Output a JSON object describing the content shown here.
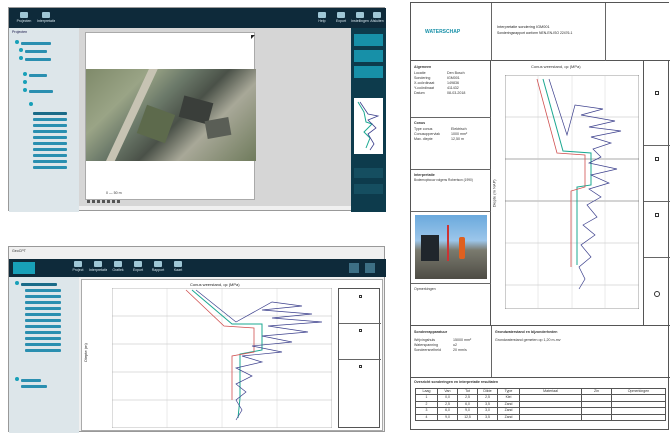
{
  "screen1": {
    "toolbar": [
      {
        "label": "Projecten",
        "icon": "folder-icon"
      },
      {
        "label": "Interpretatie",
        "icon": "layers-icon"
      }
    ],
    "toolbar_right": [
      {
        "label": "Help",
        "icon": "help-icon"
      },
      {
        "label": "Export",
        "icon": "export-icon"
      },
      {
        "label": "Instellingen",
        "icon": "gear-icon"
      },
      {
        "label": "Afsluiten",
        "icon": "close-icon"
      }
    ],
    "tree_header": "Projecten",
    "map_scale": "0 — 50 m"
  },
  "screen2": {
    "title": "GeoCPT",
    "toolbar": [
      {
        "label": "Project"
      },
      {
        "label": "Interpretatie"
      },
      {
        "label": "Grafiek"
      },
      {
        "label": "Export"
      },
      {
        "label": "Rapport"
      },
      {
        "label": "Kaart"
      }
    ],
    "chart_title": "Conus weerstand, qc (MPa)",
    "y_axis_label": "Diepte (m)"
  },
  "report": {
    "logo_text": "WATERSCHAP",
    "header_title": "Interpretatie sondering IGM001",
    "header_subtitle": "Sonderingsrapport conform NEN-EN-ISO 22476-1",
    "info_heading": "Algemeen",
    "info_rows": [
      {
        "label": "Locatie",
        "value": "Den Bosch"
      },
      {
        "label": "Sondering",
        "value": "IGM001"
      },
      {
        "label": "X-coördinaat",
        "value": "149836"
      },
      {
        "label": "Y-coördinaat",
        "value": "411432"
      },
      {
        "label": "Datum",
        "value": "08-03-2018"
      }
    ],
    "section2_heading": "Conus",
    "section2_rows": [
      {
        "label": "Type conus",
        "value": "Elektrisch"
      },
      {
        "label": "Conusoppervlak",
        "value": "1000 mm²"
      },
      {
        "label": "Max. diepte",
        "value": "12,50 m"
      }
    ],
    "section3_heading": "Interpretatie",
    "section3_text": "Bodemopbouw volgens Robertson (1990)",
    "photo_caption": "Opmerkingen",
    "chart_title": "Conus weerstand, qc (MPa)",
    "y_axis_label": "Diepte (m NAP)",
    "footer_left_title": "Sondeerapparatuur",
    "footer_rows": [
      {
        "label": "Wrijvingshuls",
        "value": "15000 mm²"
      },
      {
        "label": "Waterspanning",
        "value": "u2"
      },
      {
        "label": "Sondeersnelheid",
        "value": "20 mm/s"
      }
    ],
    "footer_right_title": "Grondwaterstand en bijzonderheden",
    "footer_right_text": "Grondwaterstand gemeten op 1,20 m-mv",
    "table_title": "Overzicht sonderingen en interpretatie resultaten",
    "table_headers": [
      "Laag",
      "Van",
      "Tot",
      "Dikte",
      "Type",
      "Materiaal",
      "Zin",
      "Opmerkingen"
    ],
    "table_rows": [
      [
        "1",
        "0,0",
        "2,5",
        "2,5",
        "Klei",
        "",
        "",
        ""
      ],
      [
        "2",
        "2,5",
        "6,0",
        "3,5",
        "Zand",
        "",
        "",
        ""
      ],
      [
        "3",
        "6,0",
        "9,0",
        "3,0",
        "Zand",
        "",
        "",
        ""
      ],
      [
        "4",
        "9,0",
        "12,5",
        "3,5",
        "Zand",
        "",
        "",
        ""
      ]
    ]
  },
  "colors": {
    "toolbar": "#0e2a3a",
    "accent": "#18a0b8",
    "trace_main": "#3b3f8c",
    "trace_teal": "#1ba891",
    "trace_red": "#d05050"
  }
}
